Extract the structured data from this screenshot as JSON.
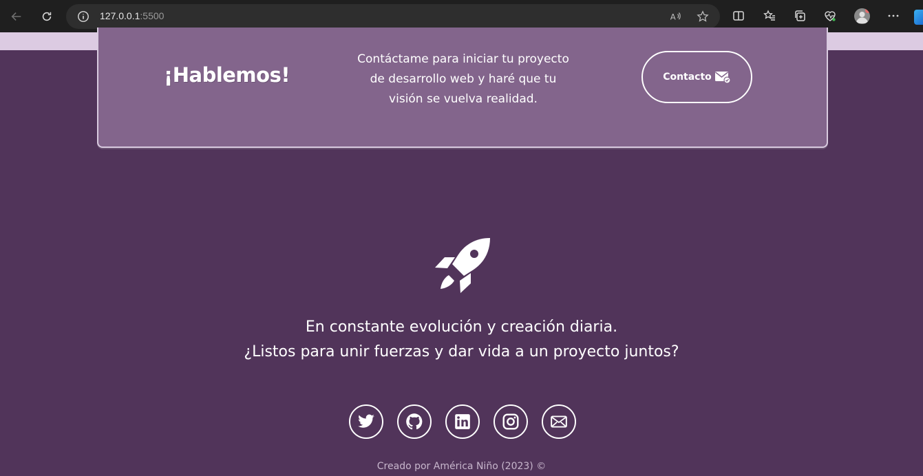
{
  "browser": {
    "url_host": "127.0.0.1",
    "url_port": ":5500"
  },
  "cta": {
    "title": "¡Hablemos!",
    "line1": "Contáctame para iniciar tu proyecto",
    "line2": "de desarrollo web y haré que tu",
    "line3": "visión se vuelva realidad.",
    "button_label": "Contacto"
  },
  "hero": {
    "line1": "En constante evolución y creación diaria.",
    "line2": "¿Listos para unir fuerzas y dar vida a un proyecto juntos?"
  },
  "socials": [
    "twitter-icon",
    "github-icon",
    "linkedin-icon",
    "instagram-icon",
    "email-icon"
  ],
  "footer": {
    "credit": "Creado por América Niño (2023) ©"
  },
  "colors": {
    "background": "#51345a",
    "card": "#83658c",
    "top_strip": "#dccbe2",
    "accent_text": "#ffffff"
  }
}
